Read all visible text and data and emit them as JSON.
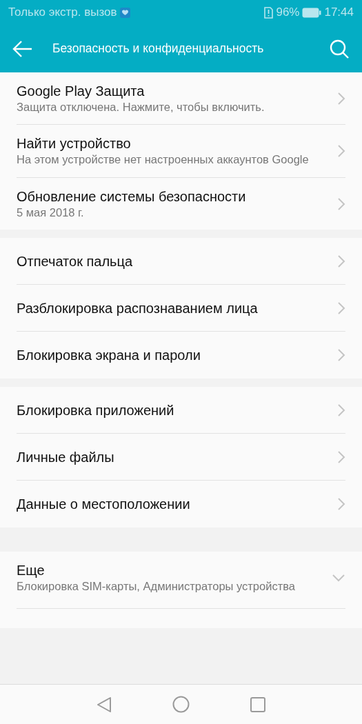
{
  "status_bar": {
    "carrier": "Только экстр. вызов",
    "battery": "96%",
    "time": "17:44"
  },
  "app_bar": {
    "title": "Безопасность и конфиденциальность"
  },
  "groups": [
    {
      "items": [
        {
          "kind": "link",
          "title": "Google Play Защита",
          "subtitle": "Защита отключена. Нажмите, чтобы включить."
        },
        {
          "kind": "link",
          "title": "Найти устройство",
          "subtitle": "На этом устройстве нет настроенных аккаунтов Google"
        },
        {
          "kind": "link",
          "title": "Обновление системы безопасности",
          "subtitle": "5 мая 2018 г."
        }
      ]
    },
    {
      "items": [
        {
          "kind": "link",
          "title": "Отпечаток пальца"
        },
        {
          "kind": "link",
          "title": "Разблокировка распознаванием лица"
        },
        {
          "kind": "link",
          "title": "Блокировка экрана и пароли"
        }
      ]
    },
    {
      "items": [
        {
          "kind": "link",
          "title": "Блокировка приложений"
        },
        {
          "kind": "link",
          "title": "Личные файлы"
        },
        {
          "kind": "link",
          "title": "Данные о местоположении"
        }
      ]
    },
    {
      "items": [
        {
          "kind": "expand",
          "title": "Еще",
          "subtitle": "Блокировка SIM-карты, Администраторы устройства",
          "expanded": false
        }
      ]
    }
  ]
}
